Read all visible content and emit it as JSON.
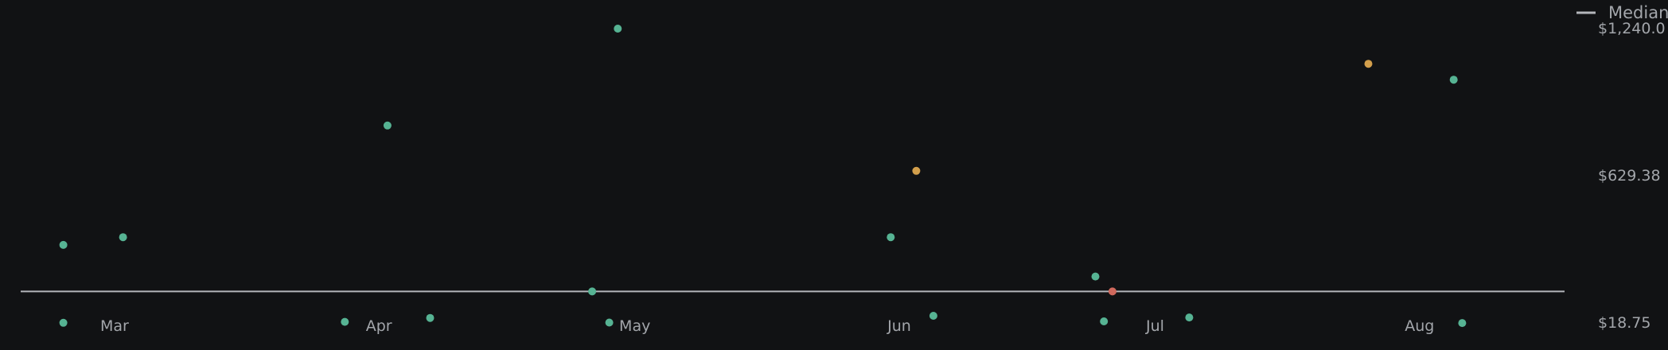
{
  "chart_data": {
    "type": "scatter",
    "title": "",
    "xlabel": "",
    "ylabel": "",
    "x_ticks": [
      {
        "label": "Mar",
        "date": "2024-03-01"
      },
      {
        "label": "Apr",
        "date": "2024-04-01"
      },
      {
        "label": "May",
        "date": "2024-05-01"
      },
      {
        "label": "Jun",
        "date": "2024-06-01"
      },
      {
        "label": "Jul",
        "date": "2024-07-01"
      },
      {
        "label": "Aug",
        "date": "2024-08-01"
      }
    ],
    "y_ticks": [
      {
        "label": "$1,240.0",
        "value": 1240.0
      },
      {
        "label": "$629.38",
        "value": 629.38
      },
      {
        "label": "$18.75",
        "value": 18.75
      }
    ],
    "xlim": [
      "2024-02-19",
      "2024-08-18"
    ],
    "ylim": [
      -40,
      1296
    ],
    "grid": false,
    "legend": {
      "placement": "top-right",
      "entries": [
        {
          "label": "Median",
          "color": "#b4b6bb"
        }
      ]
    },
    "median": {
      "value": 150
    },
    "colors": {
      "background": "#111214",
      "normal": "#56b393",
      "warning": "#d39f4c",
      "alert": "#d0695d",
      "median_line": "#b4b6bb",
      "text": "#a3a6ab"
    },
    "points": [
      {
        "date": "2024-02-24",
        "value": 20,
        "status": "normal"
      },
      {
        "date": "2024-02-24",
        "value": 343,
        "status": "normal"
      },
      {
        "date": "2024-03-02",
        "value": 375,
        "status": "normal"
      },
      {
        "date": "2024-03-28",
        "value": 24,
        "status": "normal"
      },
      {
        "date": "2024-04-02",
        "value": 838,
        "status": "normal"
      },
      {
        "date": "2024-04-07",
        "value": 40,
        "status": "normal"
      },
      {
        "date": "2024-04-26",
        "value": 150,
        "status": "normal"
      },
      {
        "date": "2024-04-28",
        "value": 21,
        "status": "normal"
      },
      {
        "date": "2024-04-29",
        "value": 1240,
        "status": "normal"
      },
      {
        "date": "2024-05-31",
        "value": 375,
        "status": "normal"
      },
      {
        "date": "2024-06-03",
        "value": 650,
        "status": "warning"
      },
      {
        "date": "2024-06-05",
        "value": 49,
        "status": "normal"
      },
      {
        "date": "2024-06-24",
        "value": 212,
        "status": "normal"
      },
      {
        "date": "2024-06-25",
        "value": 26,
        "status": "normal"
      },
      {
        "date": "2024-06-26",
        "value": 150,
        "status": "alert"
      },
      {
        "date": "2024-07-05",
        "value": 42,
        "status": "normal"
      },
      {
        "date": "2024-07-26",
        "value": 1094,
        "status": "warning"
      },
      {
        "date": "2024-08-05",
        "value": 1028,
        "status": "normal"
      },
      {
        "date": "2024-08-06",
        "value": 19,
        "status": "normal"
      }
    ]
  }
}
